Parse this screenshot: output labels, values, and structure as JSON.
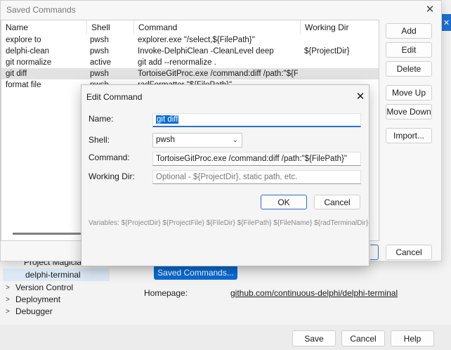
{
  "saved_dialog": {
    "title": "Saved Commands",
    "close_glyph": "✕",
    "columns": [
      "Name",
      "Shell",
      "Command",
      "Working Dir"
    ],
    "rows": [
      {
        "name": "explore to",
        "shell": "pwsh",
        "command": "explorer.exe \"/select,${FilePath}\"",
        "working_dir": ""
      },
      {
        "name": "delphi-clean",
        "shell": "pwsh",
        "command": "Invoke-DelphiClean -CleanLevel deep",
        "working_dir": "${ProjectDir}"
      },
      {
        "name": "git normalize",
        "shell": "active",
        "command": "git add --renormalize .",
        "working_dir": ""
      },
      {
        "name": "git diff",
        "shell": "pwsh",
        "command": "TortoiseGitProc.exe /command:diff /path:\"${File...",
        "working_dir": ""
      },
      {
        "name": "format file",
        "shell": "pwsh",
        "command": "radFormatter \"${FilePath}\"",
        "working_dir": ""
      }
    ],
    "selected_row": 3,
    "buttons": {
      "add": "Add",
      "edit": "Edit",
      "delete": "Delete",
      "move_up": "Move Up",
      "move_down": "Move Down",
      "import": "Import...",
      "cancel": "Cancel"
    }
  },
  "edit_dialog": {
    "title": "Edit Command",
    "close_glyph": "✕",
    "name_label": "Name:",
    "name_value": "git diff",
    "shell_label": "Shell:",
    "shell_value": "pwsh",
    "command_label": "Command:",
    "command_value": "TortoiseGitProc.exe /command:diff /path:\"${FilePath}\"",
    "working_dir_label": "Working Dir:",
    "working_dir_placeholder": "Optional - ${ProjectDir}, static path, etc.",
    "ok_label": "OK",
    "cancel_label": "Cancel",
    "variables_text": "Variables:  ${ProjectDir}  ${ProjectFile}  ${FileDir}  ${FilePath}  ${FileName}  ${radTerminalDir}"
  },
  "options_window": {
    "tree_items": [
      {
        "label": "Project Magician",
        "expander": ""
      },
      {
        "label": "delphi-terminal",
        "expander": ""
      },
      {
        "label": "Version Control",
        "expander": ">"
      },
      {
        "label": "Deployment",
        "expander": ">"
      },
      {
        "label": "Debugger",
        "expander": ">"
      }
    ],
    "saved_commands_button": "Saved Commands...",
    "homepage_label": "Homepage:",
    "homepage_link": "github.com/continuous-delphi/delphi-terminal",
    "footer": {
      "save": "Save",
      "cancel": "Cancel",
      "help": "Help"
    },
    "accent_color": "#0a6cd6"
  }
}
